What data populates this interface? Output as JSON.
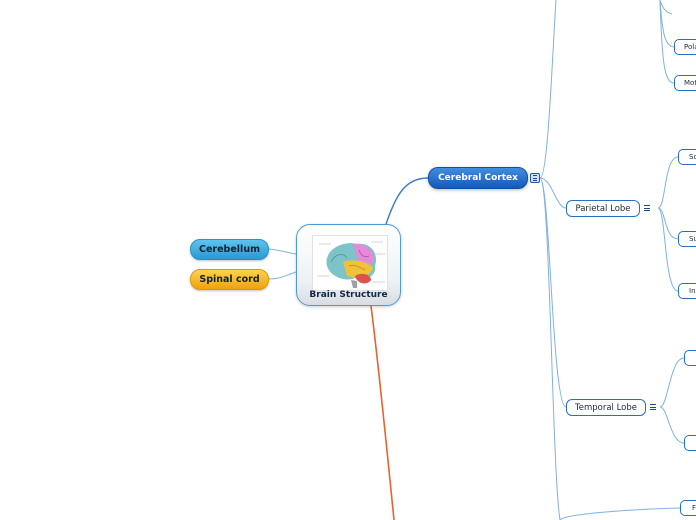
{
  "central": {
    "label": "Brain Structure",
    "image": "brain-diagram-image"
  },
  "left_topics": [
    {
      "label": "Cerebellum",
      "color": "#2a98d4"
    },
    {
      "label": "Spinal cord",
      "color": "#eea20e"
    }
  ],
  "main_topic": {
    "label": "Cerebral Cortex",
    "color": "#1658b8"
  },
  "sub_topics": [
    {
      "label": "Parietal Lobe"
    },
    {
      "label": "Temporal Lobe"
    }
  ],
  "leaves": [
    "Pola",
    "Mot",
    "So",
    "Su",
    "In",
    "",
    "",
    "F"
  ],
  "colors": {
    "connector_blue": "#7fb2e0",
    "connector_orange": "#e8622e",
    "accent": "#2470c8"
  },
  "icons": [
    "brain-diagram-image",
    "menu-icon"
  ]
}
